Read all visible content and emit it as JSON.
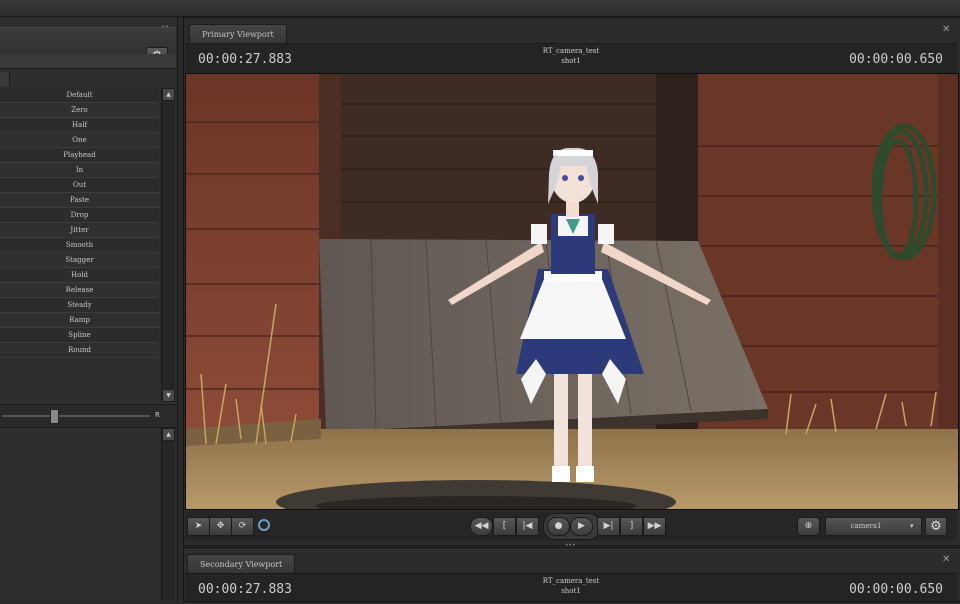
{
  "left_panel": {
    "items": [
      "Default",
      "Zero",
      "Half",
      "One",
      "Playhead",
      "In",
      "Out",
      "Paste",
      "Drop",
      "Jitter",
      "Smooth",
      "Stagger",
      "Hold",
      "Release",
      "Steady",
      "Ramp",
      "Spline",
      "Round"
    ],
    "slider_right_label": "R"
  },
  "primary_viewport": {
    "tab_label": "Primary Viewport",
    "timecode_left": "00:00:27.883",
    "timecode_right": "00:00:00.650",
    "camera_name": "RT_camera_test",
    "shot_name": "shot1"
  },
  "transport": {
    "camera_select_value": "camera1"
  },
  "secondary_viewport": {
    "tab_label": "Secondary Viewport",
    "timecode_left": "00:00:27.883",
    "timecode_right": "00:00:00.650",
    "camera_name": "RT_camera_test",
    "shot_name": "shot1"
  },
  "icons": {
    "close": "close-icon",
    "gear": "gear-icon",
    "scroll_up": "scroll-up-icon",
    "scroll_down": "scroll-down-icon"
  },
  "colors": {
    "panel_bg": "#2e2e2e",
    "viewport_bg": "#242424",
    "wall_red": "#7a3e2f",
    "wood_gray": "#6f665c",
    "ground": "#a98a5e"
  }
}
